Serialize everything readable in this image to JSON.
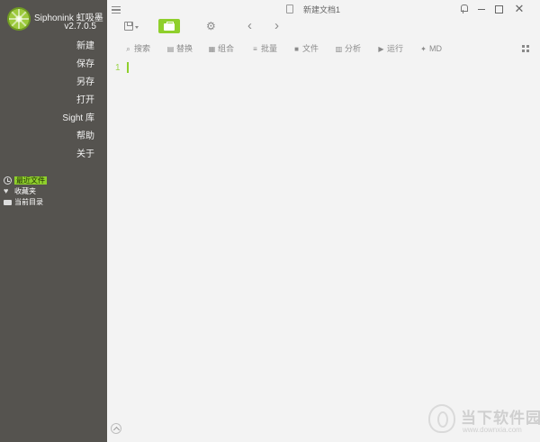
{
  "app": {
    "name": "Siphonink 虹吸墨",
    "version": "v2.7.0.5",
    "document_title": "新建文档1"
  },
  "sidebar": {
    "menu": [
      {
        "label": "新建"
      },
      {
        "label": "保存"
      },
      {
        "label": "另存"
      },
      {
        "label": "打开"
      },
      {
        "label": "Sight 库"
      },
      {
        "label": "帮助"
      },
      {
        "label": "关于"
      }
    ],
    "recent": [
      {
        "label": "最近文件",
        "icon": "clock-icon",
        "active": true
      },
      {
        "label": "收藏夹",
        "icon": "heart-icon",
        "active": false
      },
      {
        "label": "当前目录",
        "icon": "folder-icon",
        "active": false
      }
    ]
  },
  "toolbar": {
    "icons": [
      "hamburger-menu-icon",
      "save-icon",
      "toolbox-icon",
      "settings-icon",
      "back-arrow-icon",
      "forward-arrow-icon"
    ],
    "tools": [
      {
        "label": "搜索",
        "icon": "search-icon"
      },
      {
        "label": "替换",
        "icon": "replace-icon"
      },
      {
        "label": "组合",
        "icon": "combine-icon"
      },
      {
        "label": "批量",
        "icon": "batch-icon"
      },
      {
        "label": "文件",
        "icon": "folder-icon"
      },
      {
        "label": "分析",
        "icon": "chart-icon"
      },
      {
        "label": "运行",
        "icon": "play-icon"
      },
      {
        "label": "MD",
        "icon": "markdown-icon"
      }
    ]
  },
  "editor": {
    "line_number": "1"
  },
  "watermark": {
    "name": "当下软件园",
    "url": "www.downxia.com"
  },
  "colors": {
    "sidebar_bg": "#55534f",
    "accent_green": "#8fcf2c",
    "editor_bg": "#f3f3f3"
  }
}
